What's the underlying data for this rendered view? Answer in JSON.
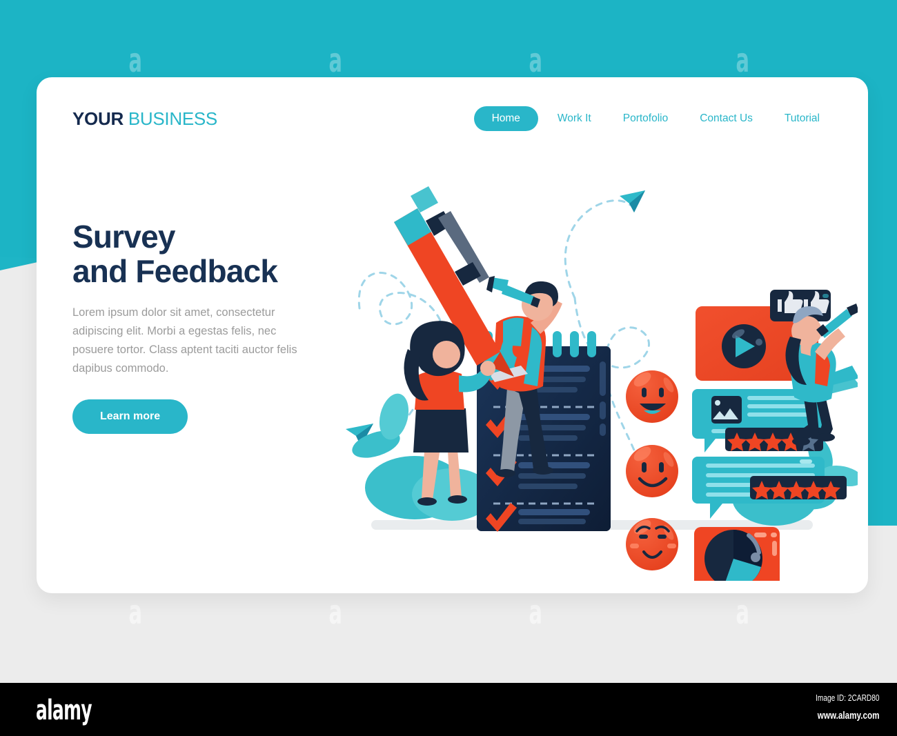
{
  "brand": {
    "logo_primary": "YOUR",
    "logo_secondary": "BUSINESS",
    "accent_teal": "#29b6c9",
    "accent_navy": "#183153",
    "accent_orange": "#ef4523"
  },
  "nav": {
    "items": [
      {
        "label": "Home",
        "active": true
      },
      {
        "label": "Work It",
        "active": false
      },
      {
        "label": "Portofolio",
        "active": false
      },
      {
        "label": "Contact Us",
        "active": false
      },
      {
        "label": "Tutorial",
        "active": false
      }
    ]
  },
  "hero": {
    "heading": "Survey\nand Feedback",
    "paragraph": "Lorem ipsum dolor sit amet, consectetur adipiscing elit. Morbi a egestas felis, nec posuere tortor. Class aptent taciti auctor felis dapibus commodo.",
    "cta_label": "Learn more"
  },
  "illustration": {
    "alt": "survey and feedback flat illustration",
    "elements": [
      "man-with-telescope-and-laptop",
      "woman-holding-giant-pen",
      "checklist-notepad",
      "emoji-laughing",
      "emoji-smiling",
      "emoji-shy",
      "video-card-with-play-button",
      "thumbs-up-badge",
      "chat-bubble-with-image",
      "star-rating-bar-four",
      "chat-bubble-text",
      "star-rating-bar-five",
      "pie-chart-bubble",
      "woman-with-telescope-on-laptop",
      "dashed-path-arrows",
      "paper-plane-arrows",
      "leaf-plants"
    ],
    "ratings": {
      "bar_one_filled": 4,
      "bar_one_total": 5,
      "bar_two_filled": 5,
      "bar_two_total": 5
    },
    "checklist_items": 4
  },
  "watermark": {
    "logo": "alamy",
    "image_id": "Image ID: 2CARD80",
    "url": "www.alamy.com"
  }
}
